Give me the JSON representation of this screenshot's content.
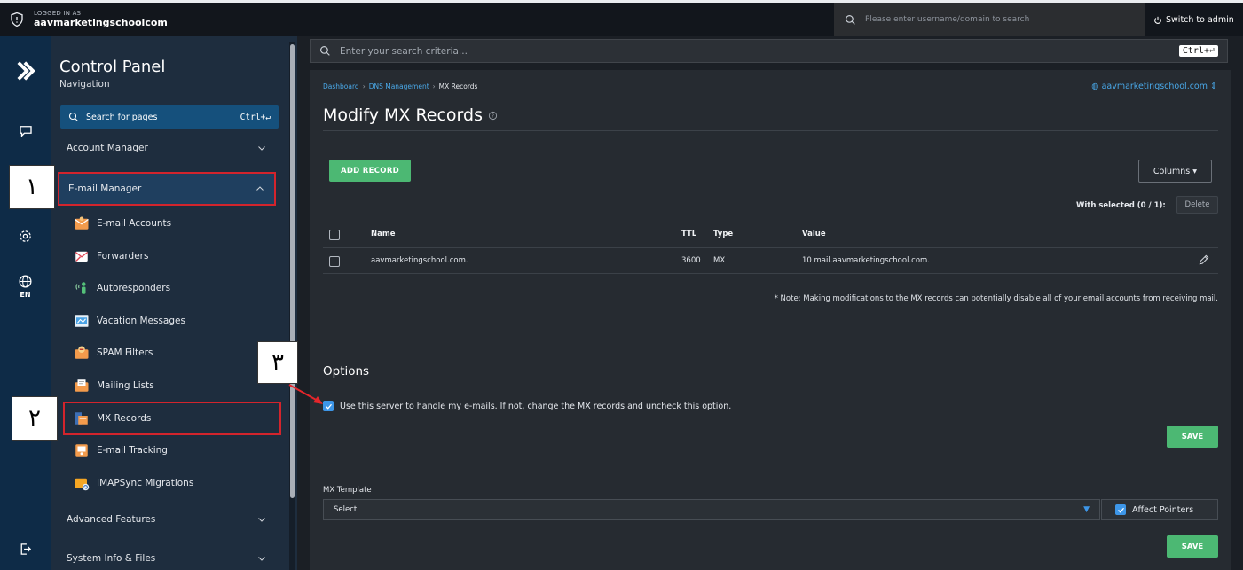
{
  "topbar": {
    "logged_label": "LOGGED IN AS",
    "username": "aavmarketingschoolcom",
    "search_placeholder": "Please enter username/domain to search",
    "switch_label": "Switch to admin"
  },
  "rail": {
    "lang": "EN"
  },
  "sidebar": {
    "title": "Control Panel",
    "subtitle": "Navigation",
    "search_label": "Search for pages",
    "search_shortcut": "Ctrl+↵",
    "groups": [
      {
        "label": "Account Manager"
      },
      {
        "label": "E-mail Manager"
      },
      {
        "label": "Advanced Features"
      },
      {
        "label": "System Info & Files"
      }
    ],
    "items": [
      {
        "label": "E-mail Accounts"
      },
      {
        "label": "Forwarders"
      },
      {
        "label": "Autoresponders"
      },
      {
        "label": "Vacation Messages"
      },
      {
        "label": "SPAM Filters"
      },
      {
        "label": "Mailing Lists"
      },
      {
        "label": "MX Records"
      },
      {
        "label": "E-mail Tracking"
      },
      {
        "label": "IMAPSync Migrations"
      }
    ]
  },
  "main": {
    "search_placeholder": "Enter your search criteria...",
    "search_shortcut": "Ctrl+⏎",
    "breadcrumb": [
      "Dashboard",
      "DNS Management",
      "MX Records"
    ],
    "domain": "aavmarketingschool.com",
    "title": "Modify MX Records",
    "add_label": "ADD RECORD",
    "columns_label": "Columns",
    "with_selected": "With selected (0 / 1):",
    "delete_label": "Delete",
    "table": {
      "headers": [
        "Name",
        "TTL",
        "Type",
        "Value"
      ],
      "rows": [
        [
          "aavmarketingschool.com.",
          "3600",
          "MX",
          "10 mail.aavmarketingschool.com."
        ]
      ]
    },
    "note": "* Note: Making modifications to the MX records can potentially disable all of your email accounts from receiving mail.",
    "options_title": "Options",
    "use_server_label": "Use this server to handle my e-mails. If not, change the MX records and uncheck this option.",
    "save_label": "SAVE",
    "mx_template_label": "MX Template",
    "select_value": "Select",
    "affect_label": "Affect Pointers"
  },
  "annotations": [
    "١",
    "٢",
    "٣"
  ],
  "colors": {
    "accent": "#3d96e8",
    "green": "#4cb873",
    "highlight": "#d3242c",
    "sidebar": "#1e2d3e",
    "rail": "#0e2b47"
  }
}
